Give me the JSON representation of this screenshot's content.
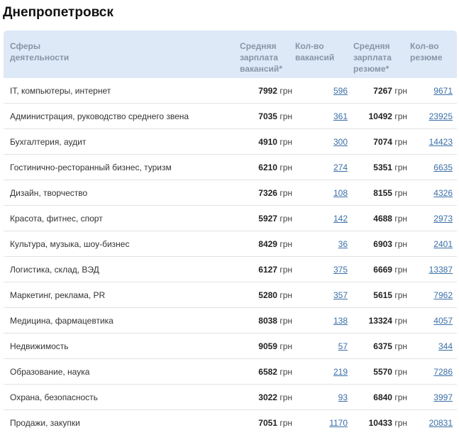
{
  "title": "Днепропетровск",
  "headers": {
    "sphere": [
      "Сферы",
      "деятельности"
    ],
    "salary_vac": [
      "Средняя",
      "зарплата",
      "вакансий*"
    ],
    "count_vac": [
      "Кол-во",
      "вакансий"
    ],
    "salary_res": [
      "Средняя",
      "зарплата",
      "резюме*"
    ],
    "count_res": [
      "Кол-во",
      "резюме"
    ]
  },
  "currency": "грн",
  "rows": [
    {
      "sphere": "IT, компьютеры, интернет",
      "salary_vac": "7992",
      "count_vac": "596",
      "salary_res": "7267",
      "count_res": "9671"
    },
    {
      "sphere": "Администрация, руководство среднего звена",
      "salary_vac": "7035",
      "count_vac": "361",
      "salary_res": "10492",
      "count_res": "23925"
    },
    {
      "sphere": "Бухгалтерия, аудит",
      "salary_vac": "4910",
      "count_vac": "300",
      "salary_res": "7074",
      "count_res": "14423"
    },
    {
      "sphere": "Гостинично-ресторанный бизнес, туризм",
      "salary_vac": "6210",
      "count_vac": "274",
      "salary_res": "5351",
      "count_res": "6635"
    },
    {
      "sphere": "Дизайн, творчество",
      "salary_vac": "7326",
      "count_vac": "108",
      "salary_res": "8155",
      "count_res": "4326"
    },
    {
      "sphere": "Красота, фитнес, спорт",
      "salary_vac": "5927",
      "count_vac": "142",
      "salary_res": "4688",
      "count_res": "2973"
    },
    {
      "sphere": "Культура, музыка, шоу-бизнес",
      "salary_vac": "8429",
      "count_vac": "36",
      "salary_res": "6903",
      "count_res": "2401"
    },
    {
      "sphere": "Логистика, склад, ВЭД",
      "salary_vac": "6127",
      "count_vac": "375",
      "salary_res": "6669",
      "count_res": "13387"
    },
    {
      "sphere": "Маркетинг, реклама, PR",
      "salary_vac": "5280",
      "count_vac": "357",
      "salary_res": "5615",
      "count_res": "7962"
    },
    {
      "sphere": "Медицина, фармацевтика",
      "salary_vac": "8038",
      "count_vac": "138",
      "salary_res": "13324",
      "count_res": "4057"
    },
    {
      "sphere": "Недвижимость",
      "salary_vac": "9059",
      "count_vac": "57",
      "salary_res": "6375",
      "count_res": "344"
    },
    {
      "sphere": "Образование, наука",
      "salary_vac": "6582",
      "count_vac": "219",
      "salary_res": "5570",
      "count_res": "7286"
    },
    {
      "sphere": "Охрана, безопасность",
      "salary_vac": "3022",
      "count_vac": "93",
      "salary_res": "6840",
      "count_res": "3997"
    },
    {
      "sphere": "Продажи, закупки",
      "salary_vac": "7051",
      "count_vac": "1170",
      "salary_res": "10433",
      "count_res": "20831"
    }
  ]
}
